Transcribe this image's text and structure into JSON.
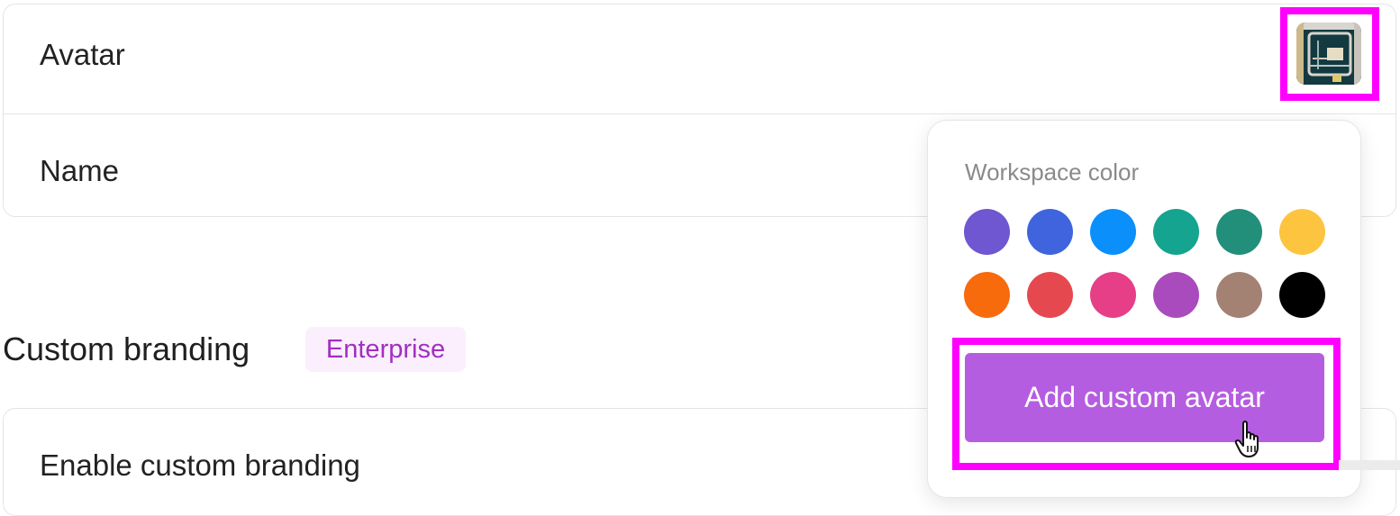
{
  "settings": {
    "avatar_label": "Avatar",
    "name_label": "Name"
  },
  "branding": {
    "title": "Custom branding",
    "badge": "Enterprise",
    "enable_label": "Enable custom branding"
  },
  "popover": {
    "heading": "Workspace color",
    "colors": [
      {
        "name": "purple",
        "hex": "#6e57d0"
      },
      {
        "name": "blue",
        "hex": "#3f64dd"
      },
      {
        "name": "sky-blue",
        "hex": "#0a8ffb"
      },
      {
        "name": "teal",
        "hex": "#14a490"
      },
      {
        "name": "dark-teal",
        "hex": "#228f7b"
      },
      {
        "name": "yellow",
        "hex": "#fdc43f"
      },
      {
        "name": "orange",
        "hex": "#f76b0d"
      },
      {
        "name": "red",
        "hex": "#e5494f"
      },
      {
        "name": "pink",
        "hex": "#e63e87"
      },
      {
        "name": "violet",
        "hex": "#a94bbd"
      },
      {
        "name": "brown",
        "hex": "#a38173"
      },
      {
        "name": "black",
        "hex": "#000000"
      }
    ],
    "add_button_label": "Add custom avatar"
  },
  "highlight_color": "#ff00ff"
}
